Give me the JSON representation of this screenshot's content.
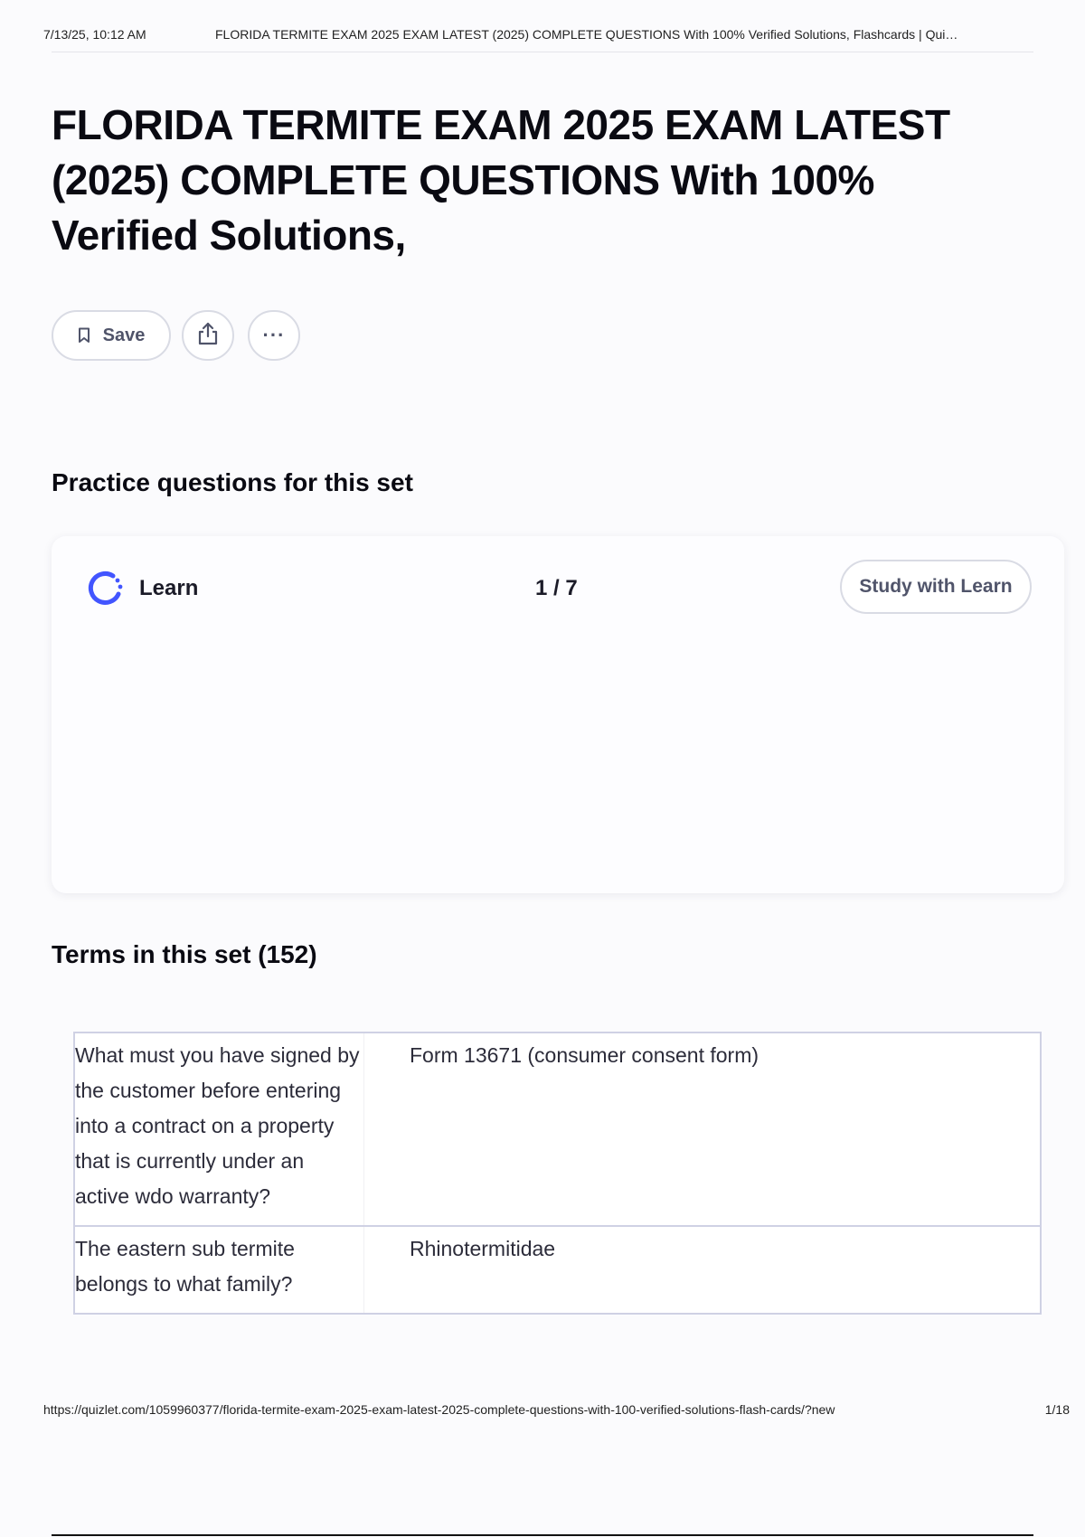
{
  "print_header": {
    "date": "7/13/25, 10:12 AM",
    "doc_title": "FLORIDA TERMITE EXAM 2025 EXAM LATEST (2025) COMPLETE QUESTIONS With 100% Verified Solutions, Flashcards | Qui…"
  },
  "main_title": "FLORIDA TERMITE EXAM 2025 EXAM LATEST (2025) COMPLETE QUESTIONS With 100% Verified Solutions,",
  "actions": {
    "save_label": "Save",
    "bookmark_icon": "bookmark-icon",
    "share_icon": "share-icon",
    "more_icon": "more-horizontal-icon",
    "more_glyph": "···"
  },
  "practice": {
    "heading": "Practice questions for this set",
    "mode_label": "Learn",
    "progress": "1 / 7",
    "study_button_label": "Study with Learn",
    "accent_color": "#4255ff"
  },
  "terms": {
    "heading": "Terms in this set (152)",
    "rows": [
      {
        "term": "What must you have signed by the customer before entering into a contract on a property that is currently under an active wdo warranty?",
        "definition": "Form 13671 (consumer consent form)"
      },
      {
        "term": "The eastern sub termite belongs to what family?",
        "definition": "Rhinotermitidae"
      }
    ]
  },
  "print_footer": {
    "url": "https://quizlet.com/1059960377/florida-termite-exam-2025-exam-latest-2025-complete-questions-with-100-verified-solutions-flash-cards/?new",
    "page": "1/18"
  }
}
